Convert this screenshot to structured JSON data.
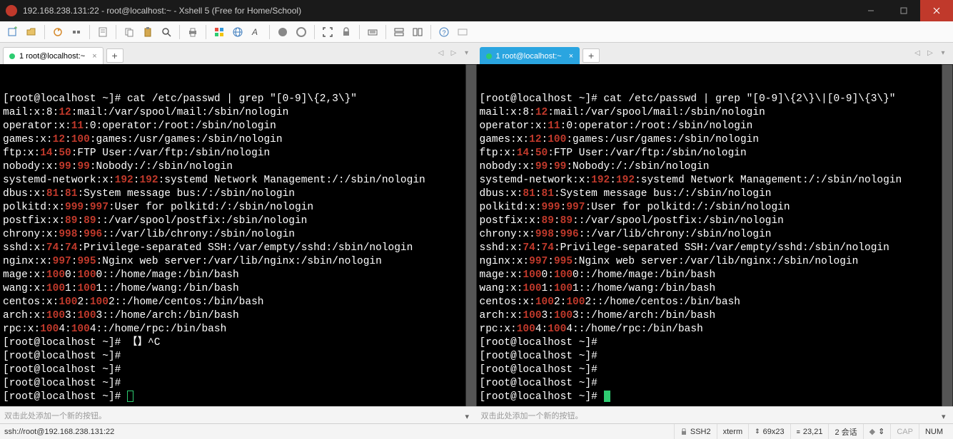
{
  "window": {
    "title": "192.168.238.131:22 - root@localhost:~ - Xshell 5 (Free for Home/School)"
  },
  "tabs": {
    "left_label": "1 root@localhost:~",
    "right_label": "1 root@localhost:~"
  },
  "terminal_left": {
    "cmd_prompt": "[root@localhost ~]# ",
    "cmd": "cat /etc/passwd | grep \"[0-9]\\{2,3\\}\"",
    "lines": [
      {
        "pre": "mail:x:8:",
        "hl": "12",
        "post": ":mail:/var/spool/mail:/sbin/nologin"
      },
      {
        "pre": "operator:x:",
        "hl": "11",
        "post": ":0:operator:/root:/sbin/nologin"
      },
      {
        "pre": "games:x:",
        "hl": "12",
        "mid": ":",
        "hl2": "100",
        "post": ":games:/usr/games:/sbin/nologin"
      },
      {
        "pre": "ftp:x:",
        "hl": "14",
        "mid": ":",
        "hl2": "50",
        "post": ":FTP User:/var/ftp:/sbin/nologin"
      },
      {
        "pre": "nobody:x:",
        "hl": "99",
        "mid": ":",
        "hl2": "99",
        "post": ":Nobody:/:/sbin/nologin"
      },
      {
        "pre": "systemd-network:x:",
        "hl": "192",
        "mid": ":",
        "hl2": "192",
        "post": ":systemd Network Management:/:/sbin/nologin"
      },
      {
        "pre": "dbus:x:",
        "hl": "81",
        "mid": ":",
        "hl2": "81",
        "post": ":System message bus:/:/sbin/nologin"
      },
      {
        "pre": "polkitd:x:",
        "hl": "999",
        "mid": ":",
        "hl2": "997",
        "post": ":User for polkitd:/:/sbin/nologin"
      },
      {
        "pre": "postfix:x:",
        "hl": "89",
        "mid": ":",
        "hl2": "89",
        "post": "::/var/spool/postfix:/sbin/nologin"
      },
      {
        "pre": "chrony:x:",
        "hl": "998",
        "mid": ":",
        "hl2": "996",
        "post": "::/var/lib/chrony:/sbin/nologin"
      },
      {
        "pre": "sshd:x:",
        "hl": "74",
        "mid": ":",
        "hl2": "74",
        "post": ":Privilege-separated SSH:/var/empty/sshd:/sbin/nologin"
      },
      {
        "pre": "nginx:x:",
        "hl": "997",
        "mid": ":",
        "hl2": "995",
        "post": ":Nginx web server:/var/lib/nginx:/sbin/nologin"
      },
      {
        "pre": "mage:x:",
        "hl": "100",
        "mid": "0:",
        "hl2": "100",
        "post": "0::/home/mage:/bin/bash"
      },
      {
        "pre": "wang:x:",
        "hl": "100",
        "mid": "1:",
        "hl2": "100",
        "post": "1::/home/wang:/bin/bash"
      },
      {
        "pre": "centos:x:",
        "hl": "100",
        "mid": "2:",
        "hl2": "100",
        "post": "2::/home/centos:/bin/bash"
      },
      {
        "pre": "arch:x:",
        "hl": "100",
        "mid": "3:",
        "hl2": "100",
        "post": "3::/home/arch:/bin/bash"
      },
      {
        "pre": "rpc:x:",
        "hl": "100",
        "mid": "4:",
        "hl2": "100",
        "post": "4::/home/rpc:/bin/bash"
      }
    ],
    "extra_prompts": [
      "[root@localhost ~]# 【】^C",
      "[root@localhost ~]# ",
      "[root@localhost ~]# ",
      "[root@localhost ~]# ",
      "[root@localhost ~]# "
    ]
  },
  "terminal_right": {
    "cmd_prompt": "[root@localhost ~]# ",
    "cmd": "cat /etc/passwd | grep \"[0-9]\\{2\\}\\|[0-9]\\{3\\}\"",
    "lines": [
      {
        "pre": "mail:x:8:",
        "hl": "12",
        "post": ":mail:/var/spool/mail:/sbin/nologin"
      },
      {
        "pre": "operator:x:",
        "hl": "11",
        "post": ":0:operator:/root:/sbin/nologin"
      },
      {
        "pre": "games:x:",
        "hl": "12",
        "mid": ":",
        "hl2": "100",
        "post": ":games:/usr/games:/sbin/nologin"
      },
      {
        "pre": "ftp:x:",
        "hl": "14",
        "mid": ":",
        "hl2": "50",
        "post": ":FTP User:/var/ftp:/sbin/nologin"
      },
      {
        "pre": "nobody:x:",
        "hl": "99",
        "mid": ":",
        "hl2": "99",
        "post": ":Nobody:/:/sbin/nologin"
      },
      {
        "pre": "systemd-network:x:",
        "hl": "192",
        "mid": ":",
        "hl2": "192",
        "post": ":systemd Network Management:/:/sbin/nologin"
      },
      {
        "pre": "dbus:x:",
        "hl": "81",
        "mid": ":",
        "hl2": "81",
        "post": ":System message bus:/:/sbin/nologin"
      },
      {
        "pre": "polkitd:x:",
        "hl": "999",
        "mid": ":",
        "hl2": "997",
        "post": ":User for polkitd:/:/sbin/nologin"
      },
      {
        "pre": "postfix:x:",
        "hl": "89",
        "mid": ":",
        "hl2": "89",
        "post": "::/var/spool/postfix:/sbin/nologin"
      },
      {
        "pre": "chrony:x:",
        "hl": "998",
        "mid": ":",
        "hl2": "996",
        "post": "::/var/lib/chrony:/sbin/nologin"
      },
      {
        "pre": "sshd:x:",
        "hl": "74",
        "mid": ":",
        "hl2": "74",
        "post": ":Privilege-separated SSH:/var/empty/sshd:/sbin/nologin"
      },
      {
        "pre": "nginx:x:",
        "hl": "997",
        "mid": ":",
        "hl2": "995",
        "post": ":Nginx web server:/var/lib/nginx:/sbin/nologin"
      },
      {
        "pre": "mage:x:",
        "hl": "100",
        "mid": "0:",
        "hl2": "100",
        "post": "0::/home/mage:/bin/bash"
      },
      {
        "pre": "wang:x:",
        "hl": "100",
        "mid": "1:",
        "hl2": "100",
        "post": "1::/home/wang:/bin/bash"
      },
      {
        "pre": "centos:x:",
        "hl": "100",
        "mid": "2:",
        "hl2": "100",
        "post": "2::/home/centos:/bin/bash"
      },
      {
        "pre": "arch:x:",
        "hl": "100",
        "mid": "3:",
        "hl2": "100",
        "post": "3::/home/arch:/bin/bash"
      },
      {
        "pre": "rpc:x:",
        "hl": "100",
        "mid": "4:",
        "hl2": "100",
        "post": "4::/home/rpc:/bin/bash"
      }
    ],
    "extra_prompts": [
      "[root@localhost ~]# ",
      "[root@localhost ~]# ",
      "[root@localhost ~]# ",
      "[root@localhost ~]# ",
      "[root@localhost ~]# "
    ]
  },
  "quickbar": {
    "hint": "双击此处添加一个新的按钮。"
  },
  "statusbar": {
    "conn": "ssh://root@192.168.238.131:22",
    "ssh": "SSH2",
    "term": "xterm",
    "size": "69x23",
    "pos": "23,21",
    "sessions": "2 会话",
    "cap": "CAP",
    "num": "NUM"
  }
}
